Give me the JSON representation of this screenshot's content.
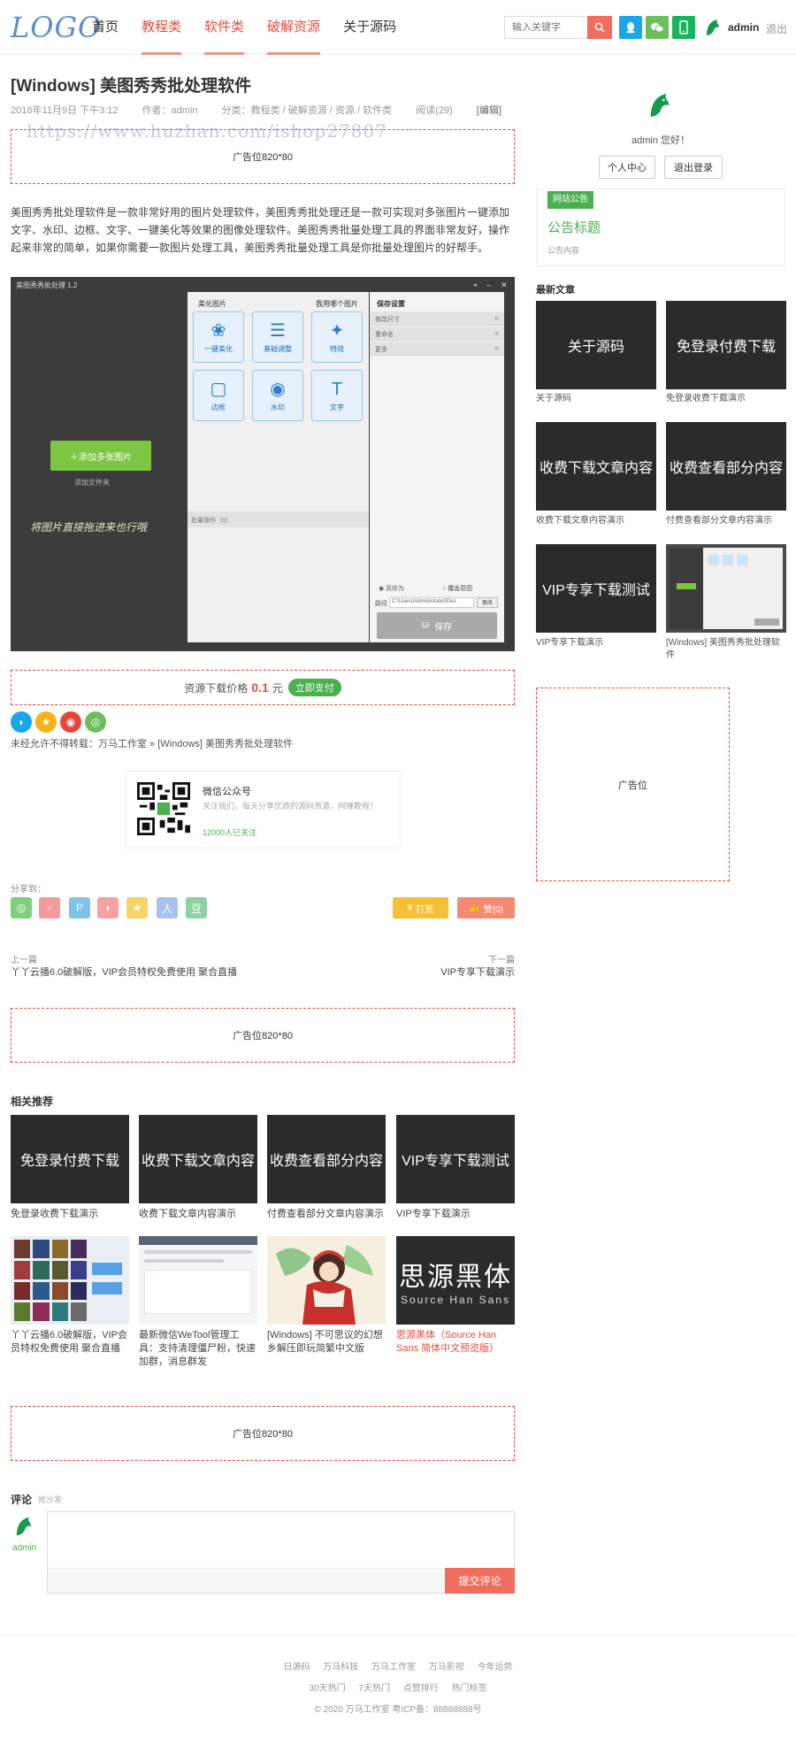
{
  "header": {
    "logo": "LOGO",
    "nav": [
      "首页",
      "教程类",
      "软件类",
      "破解资源",
      "关于源码"
    ],
    "search_placeholder": "输入关键字",
    "username": "admin",
    "logout": "退出"
  },
  "article": {
    "title": "[Windows] 美图秀秀批处理软件",
    "date": "2018年11月9日 下午3:12",
    "author": "作者：admin",
    "category": "分类：教程类 / 破解资源 / 资源 / 软件类",
    "views": "阅读(29)",
    "edit": "[编辑]",
    "watermark": "https://www.huzhan.com/ishop27807",
    "ad_top": "广告位820*80",
    "paragraph": "美图秀秀批处理软件是一款非常好用的图片处理软件，美图秀秀批处理还是一款可实现对多张图片一键添加文字、水印、边框、文字、一键美化等效果的图像处理软件。美图秀秀批量处理工具的界面非常友好，操作起来非常的简单，如果你需要一款图片处理工具，美图秀秀批量处理工具是你批量处理图片的好帮手。"
  },
  "app_screenshot": {
    "title": "美图秀秀批处理 1.2",
    "add_button": "添加多张图片",
    "add_sub": "添加文件夹",
    "hint": "将图片直接拖进来也行哦",
    "panel_title": "美化图片",
    "panel_link": "我用哪个图片",
    "tools": [
      "一键美化",
      "基础调整",
      "特效",
      "边框",
      "水印",
      "文字"
    ],
    "batch": "批量操作（0）",
    "save_title": "保存设置",
    "save_rows": [
      "修改尺寸",
      "重命名",
      "更多"
    ],
    "save_opt1": "另存为",
    "save_opt2": "覆盖原图",
    "path_label": "路径",
    "path_value": "C:\\Users\\Administrator\\Des",
    "browse": "更改",
    "save_button": "保存"
  },
  "price": {
    "label": "资源下载价格",
    "value": "0.1",
    "unit": "元",
    "pay": "立即支付"
  },
  "copyright_line": "未经允许不得转载：万马工作室 » [Windows] 美图秀秀批处理软件",
  "wechat": {
    "title": "微信公众号",
    "desc": "关注我们，每天分享优质的源码资源，网赚教程！",
    "count": "12000人已关注"
  },
  "share": {
    "label": "分享到：",
    "tip": "打赏",
    "like": "赞(0)"
  },
  "nav_posts": {
    "prev_label": "上一篇",
    "prev_title": "丫丫云播6.0破解版，VIP会员特权免费使用 聚合直播",
    "next_label": "下一篇",
    "next_title": "VIP专享下载演示"
  },
  "ad_mid": "广告位820*80",
  "related": {
    "heading": "相关推荐",
    "row1": [
      {
        "thumb": "免登录付费下载",
        "caption": "免登录收费下载演示"
      },
      {
        "thumb": "收费下载文章内容",
        "caption": "收费下载文章内容演示"
      },
      {
        "thumb": "收费查看部分内容",
        "caption": "付费查看部分文章内容演示"
      },
      {
        "thumb": "VIP专享下载测试",
        "caption": "VIP专享下载演示"
      }
    ],
    "row2": [
      {
        "caption": "丫丫云播6.0破解版，VIP会员特权免费使用 聚合直播"
      },
      {
        "caption": "最新微信WeTool管理工具：支持清理僵尸粉，快速加群，消息群发"
      },
      {
        "caption": "[Windows] 不可思议的幻想乡解压即玩简繁中文版"
      },
      {
        "caption": "思源黑体（Source Han Sans 简体中文预览版）",
        "thumb_big": "思源黑体",
        "thumb_small": "Source Han Sans"
      }
    ]
  },
  "ad_bottom": "广告位820*80",
  "comments": {
    "label": "评论",
    "sub": "抢沙发",
    "user": "admin",
    "submit": "提交评论"
  },
  "footer": {
    "links1": [
      "日源码",
      "万马科技",
      "万马工作室",
      "万马影视",
      "今年运势"
    ],
    "links2": [
      "30天热门",
      "7天热门",
      "点赞排行",
      "热门标签"
    ],
    "copy": "© 2020 万马工作室   粤ICP备：88888888号"
  },
  "sidebar": {
    "greeting": "admin 您好！",
    "profile_btn": "个人中心",
    "logout_btn": "退出登录",
    "notice_tag": "网站公告",
    "notice_title": "公告标题",
    "notice_body": "公告内容",
    "latest_heading": "最新文章",
    "latest": [
      {
        "thumb": "关于源码",
        "caption": "关于源码"
      },
      {
        "thumb": "免登录付费下载",
        "caption": "免登录收费下载演示"
      },
      {
        "thumb": "收费下载文章内容",
        "caption": "收费下载文章内容演示"
      },
      {
        "thumb": "收费查看部分内容",
        "caption": "付费查看部分文章内容演示"
      },
      {
        "thumb": "VIP专享下载测试",
        "caption": "VIP专享下载演示"
      },
      {
        "caption": "[Windows] 美图秀秀批处理软件"
      }
    ],
    "ad": "广告位"
  },
  "colors": {
    "accent": "#e74c3c",
    "green": "#4caf50",
    "qq_blue": "#1aa7e8",
    "wechat_green": "#6cc05b"
  }
}
